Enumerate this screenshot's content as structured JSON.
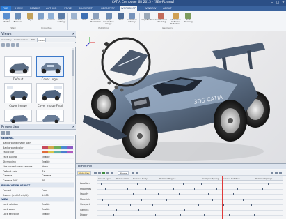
{
  "titlebar": {
    "title": "CATIA Composer 6R 2015 - [SEV-FL.smg]"
  },
  "tabs": [
    "FILE",
    "HOME",
    "RENDER",
    "AUTHOR",
    "STYLE",
    "BLUEPRINT",
    "GEOMETRY",
    "WORKSHOP",
    "WINDOW",
    "ABOUT"
  ],
  "active_tab": "WORKSHOP",
  "ribbon": {
    "buttons": [
      "Getting Started",
      "Model Browser",
      "Style",
      "Filters",
      "Variant",
      "Image Settings",
      "Viewer",
      "SVG",
      "Technical Illustration",
      "High Resolution Image",
      "Video",
      "Animation Library",
      "Simplification",
      "Interference Checking",
      "Interactive Collision Detection",
      "Path Planning"
    ],
    "groups": [
      "Start",
      "Properties",
      "Publishing",
      "Geometry"
    ]
  },
  "views": {
    "title": "Views",
    "tabs": [
      "Assembly",
      "Collaboration",
      "BOM",
      "Views"
    ],
    "active_tab": "Views",
    "thumbs": [
      "Default",
      "Cover Logos",
      "Cover Image",
      "Cover Image Final",
      "Camera View",
      "Clean View"
    ]
  },
  "properties": {
    "title": "Properties",
    "rows": [
      {
        "k": "GENERAL",
        "v": "",
        "sec": true
      },
      {
        "k": "Background image path",
        "v": ""
      },
      {
        "k": "Background color",
        "v": ""
      },
      {
        "k": "Fast color",
        "v": ""
      },
      {
        "k": "Face culling",
        "v": "Enable"
      },
      {
        "k": "Stereoview",
        "v": "Enable"
      },
      {
        "k": "Use current view camera",
        "v": "None"
      },
      {
        "k": "Default axis",
        "v": "Z+"
      },
      {
        "k": "Camera",
        "v": "Camera"
      },
      {
        "k": "Camera FOV",
        "v": "40"
      },
      {
        "k": "PUBLICATION ASPECT",
        "v": "",
        "sec": true
      },
      {
        "k": "Format",
        "v": "Free"
      },
      {
        "k": "Aspect (width/height)",
        "v": "1.000"
      },
      {
        "k": "VIEW",
        "v": "",
        "sec": true
      },
      {
        "k": "Lock rotation",
        "v": "Enable"
      },
      {
        "k": "Lock zoom",
        "v": "Enable"
      },
      {
        "k": "Lock selection",
        "v": "Enable"
      }
    ]
  },
  "timeline": {
    "title": "Timeline",
    "buttons": [
      "Auto Key",
      "Where"
    ],
    "labels": [
      "Close Logos",
      "Remove Car",
      "Remove Body",
      "Remove Engine",
      "Collapse Spring",
      "Remove Rotation",
      "Remove Springs"
    ],
    "tracks": [
      "Location",
      "Properties",
      "Opacity",
      "Materials",
      "Viewport",
      "Camera",
      "Digger"
    ]
  },
  "colors": {
    "accent": "#2b4f86",
    "tab_file": "#2c7bd5",
    "cursor": "#e03a3a",
    "car_body": "#5d6f86"
  }
}
